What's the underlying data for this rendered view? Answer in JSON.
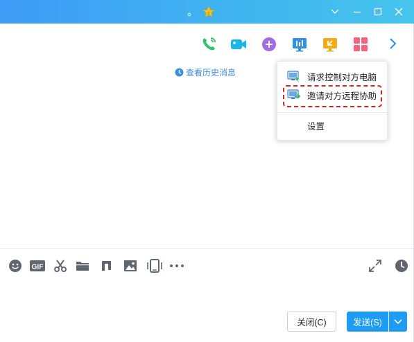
{
  "window": {
    "title": "。",
    "title_badge_icon": "star-badge-icon",
    "controls": [
      "collapse-icon",
      "minimize-icon",
      "maximize-icon",
      "close-icon"
    ]
  },
  "toolbar": {
    "icons": [
      "voice-call-icon",
      "video-call-icon",
      "add-member-icon",
      "share-screen-icon",
      "remote-assist-icon",
      "apps-icon",
      "chevron-right-icon"
    ]
  },
  "history": {
    "label": "查看历史消息"
  },
  "menu": {
    "items": [
      {
        "label": "请求控制对方电脑",
        "icon": "remote-control-icon"
      },
      {
        "label": "邀请对方远程协助",
        "icon": "remote-invite-icon"
      },
      {
        "label": "设置"
      }
    ]
  },
  "input_toolbar": {
    "icons": [
      "emoji-icon",
      "gif-icon",
      "scissors-icon",
      "folder-icon",
      "music-icon",
      "image-icon",
      "shake-icon",
      "more-icon",
      "expand-icon",
      "clock-icon"
    ],
    "gif_text": "GIF"
  },
  "buttons": {
    "close_label": "关闭(C)",
    "send_label": "发送(S)"
  },
  "colors": {
    "titlebar_start": "#3f9bf7",
    "titlebar_end": "#46c4ee",
    "send": "#1e9bf3",
    "link": "#3f8fe0",
    "highlight": "#d9241b"
  }
}
